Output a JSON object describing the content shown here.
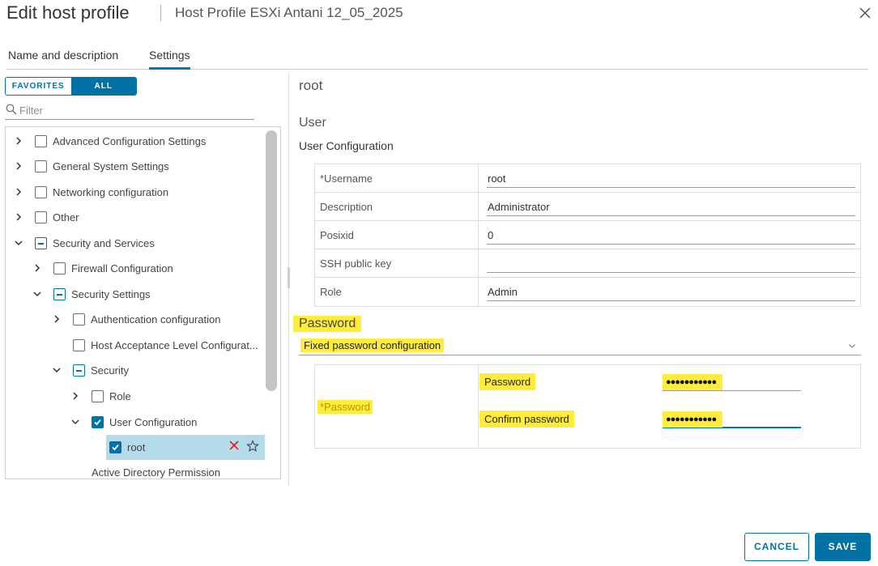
{
  "dialog": {
    "title": "Edit host profile",
    "subtitle": "Host Profile ESXi Antani 12_05_2025"
  },
  "tabs": [
    {
      "label": "Name and description",
      "active": false
    },
    {
      "label": "Settings",
      "active": true
    }
  ],
  "filter_toggle": {
    "favorites": "FAVORITES",
    "all": "ALL",
    "selected": "all"
  },
  "filter": {
    "placeholder": "Filter",
    "value": ""
  },
  "tree": [
    {
      "label": "Advanced Configuration Settings",
      "expanded": false,
      "check": "unchecked"
    },
    {
      "label": "General System Settings",
      "expanded": false,
      "check": "unchecked"
    },
    {
      "label": "Networking configuration",
      "expanded": false,
      "check": "unchecked"
    },
    {
      "label": "Other",
      "expanded": false,
      "check": "unchecked"
    },
    {
      "label": "Security and Services",
      "expanded": true,
      "check": "partial"
    },
    {
      "label": "Firewall Configuration",
      "expanded": false,
      "check": "unchecked"
    },
    {
      "label": "Security Settings",
      "expanded": true,
      "check": "partial"
    },
    {
      "label": "Authentication configuration",
      "expanded": false,
      "check": "unchecked"
    },
    {
      "label": "Host Acceptance Level Configurat...",
      "expanded": null,
      "check": "unchecked"
    },
    {
      "label": "Security",
      "expanded": true,
      "check": "partial"
    },
    {
      "label": "Role",
      "expanded": false,
      "check": "unchecked"
    },
    {
      "label": "User Configuration",
      "expanded": true,
      "check": "checked"
    },
    {
      "label": "root",
      "expanded": null,
      "check": "checked",
      "selected": true
    },
    {
      "label": "Active Directory Permission",
      "expanded": null,
      "check": null
    }
  ],
  "detail": {
    "title": "root",
    "section": "User",
    "subsection": "User Configuration",
    "fields": [
      {
        "label": "*Username",
        "value": "root"
      },
      {
        "label": "Description",
        "value": "Administrator"
      },
      {
        "label": "Posixid",
        "value": "0"
      },
      {
        "label": "SSH public key",
        "value": ""
      },
      {
        "label": "Role",
        "value": "Admin"
      }
    ],
    "password": {
      "title": "Password",
      "option": "Fixed password configuration",
      "group_label": "*Password",
      "password_label": "Password",
      "password_mask": "●●●●●●●●●●●",
      "confirm_label": "Confirm password",
      "confirm_mask": "●●●●●●●●●●●"
    }
  },
  "footer": {
    "cancel": "CANCEL",
    "save": "SAVE"
  },
  "colors": {
    "accent": "#0072a3",
    "highlight": "#ffec3d",
    "selected_row": "#b3dbea",
    "delete": "#e02020"
  }
}
